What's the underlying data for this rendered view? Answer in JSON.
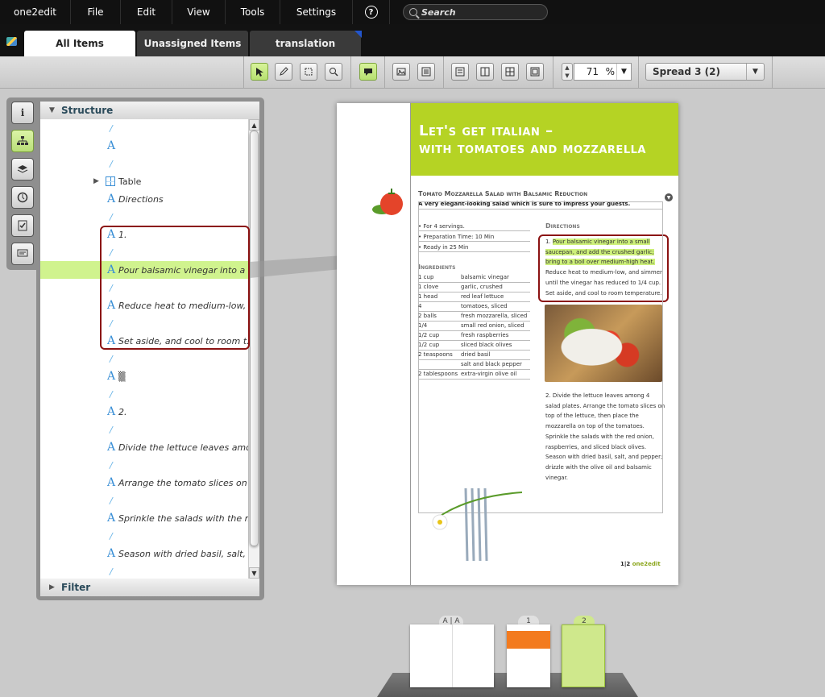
{
  "menubar": {
    "brand": "one2edit",
    "items": [
      "File",
      "Edit",
      "View",
      "Tools",
      "Settings"
    ],
    "help_icon": "?",
    "search_placeholder": "Search"
  },
  "tabs": [
    {
      "label": "All Items",
      "active": true
    },
    {
      "label": "Unassigned Items",
      "active": false
    },
    {
      "label": "translation",
      "active": false
    }
  ],
  "toolbar": {
    "zoom_value": "71",
    "zoom_unit": "%",
    "spread": "Spread 3 (2)"
  },
  "structure_panel": {
    "title": "Structure",
    "footer": "Filter",
    "rows": [
      {
        "kind": "slash",
        "text": "/"
      },
      {
        "kind": "text",
        "text": ""
      },
      {
        "kind": "slash",
        "text": "/"
      },
      {
        "kind": "table",
        "text": "Table"
      },
      {
        "kind": "text",
        "text": "Directions"
      },
      {
        "kind": "slash",
        "text": "/"
      },
      {
        "kind": "text",
        "text": "1."
      },
      {
        "kind": "slash",
        "text": "/"
      },
      {
        "kind": "text",
        "text": "Pour balsamic vinegar into a ...",
        "selected": true
      },
      {
        "kind": "slash",
        "text": "/"
      },
      {
        "kind": "text",
        "text": "Reduce heat to medium-low, ..."
      },
      {
        "kind": "slash",
        "text": "/"
      },
      {
        "kind": "text",
        "text": "Set aside, and cool to room t..."
      },
      {
        "kind": "slash",
        "text": "/"
      },
      {
        "kind": "text",
        "text": "▒"
      },
      {
        "kind": "slash",
        "text": "/"
      },
      {
        "kind": "text",
        "text": "2."
      },
      {
        "kind": "slash",
        "text": "/"
      },
      {
        "kind": "text",
        "text": "Divide the lettuce leaves amo..."
      },
      {
        "kind": "slash",
        "text": "/"
      },
      {
        "kind": "text",
        "text": "Arrange the tomato slices on ..."
      },
      {
        "kind": "slash",
        "text": "/"
      },
      {
        "kind": "text",
        "text": "Sprinkle the salads with the r..."
      },
      {
        "kind": "slash",
        "text": "/"
      },
      {
        "kind": "text",
        "text": "Season with dried basil, salt, ..."
      },
      {
        "kind": "slash",
        "text": "/"
      }
    ]
  },
  "document": {
    "headline_1": "Let's get italian –",
    "headline_2": "with tomatoes and mozzarella",
    "subtitle": "Tomato Mozzarella Salad with Balsamic Reduction",
    "tagline": "A very elegant-looking salad which is sure to impress your guests.",
    "info": [
      "• For 4 servings.",
      "• Preparation Time: 10 Min",
      "• Ready in 25 Min"
    ],
    "ingredients_heading": "Ingredients",
    "ingredients": [
      [
        "1 cup",
        "balsamic vinegar"
      ],
      [
        "1 clove",
        "garlic, crushed"
      ],
      [
        "1 head",
        "red leaf lettuce"
      ],
      [
        "4",
        "tomatoes, sliced"
      ],
      [
        "2 balls",
        "fresh mozzarella, sliced"
      ],
      [
        "1/4",
        "small red onion, sliced"
      ],
      [
        "1/2 cup",
        "fresh raspberries"
      ],
      [
        "1/2 cup",
        "sliced black olives"
      ],
      [
        "2 teaspoons",
        "dried basil"
      ],
      [
        "",
        "salt and black pepper"
      ],
      [
        "2 tablespoons",
        "extra-virgin olive oil"
      ]
    ],
    "directions_heading": "Directions",
    "step1_prefix": "1. ",
    "step1_highlight": "Pour balsamic vinegar into a small saucepan, and add the crushed garlic; bring to a boil over medium-high heat.",
    "step1_rest": " Reduce heat to medium-low, and simmer until the vinegar has reduced to 1/4 cup. Set aside, and cool to room temperature.",
    "step2": "2. Divide the lettuce leaves among 4 salad plates. Arrange the tomato slices on top of the lettuce, then place the mozzarella on top of the tomatoes. Sprinkle the salads with the red onion, raspberries, and sliced black olives. Season with dried basil, salt, and pepper; drizzle with the olive oil and balsamic vinegar.",
    "brand_badge_a": "1|2",
    "brand_badge_b": "one2edit"
  },
  "thumbnails": [
    {
      "label": "A | A"
    },
    {
      "label": "1"
    },
    {
      "label": "2"
    }
  ],
  "colors": {
    "accent_green": "#b5d324",
    "highlight": "#d0f38e",
    "callout": "#8b1212"
  }
}
